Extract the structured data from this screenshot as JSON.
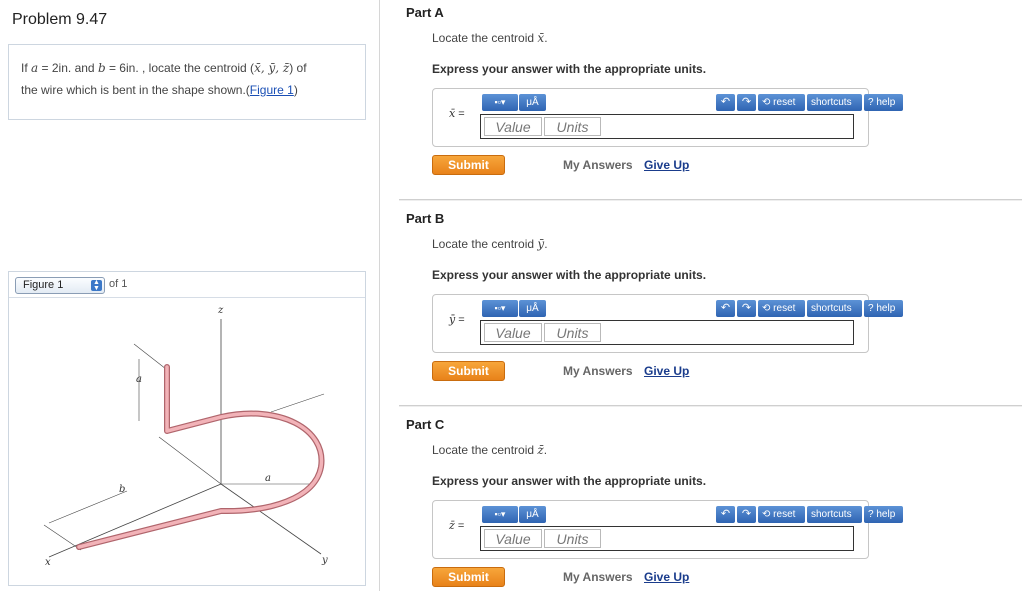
{
  "problem": {
    "title": "Problem 9.47",
    "text_prefix": "If",
    "a_var": "a",
    "a_value": "= 2in.",
    "and": "and",
    "b_var": "b",
    "b_value": "= 6in. , locate the centroid (",
    "centroid_vars": "x̄, ȳ, z̄",
    "text_suffix": ") of",
    "line2": "the wire which is bent in the shape shown.(",
    "figure_link": "Figure 1",
    "close_paren": ")"
  },
  "figure": {
    "select_label": "Figure 1",
    "of_label": "of 1",
    "labels": {
      "z": "z",
      "a_top": "a",
      "b": "b",
      "a_mid": "a",
      "x": "x",
      "y": "y"
    }
  },
  "toolbar": {
    "template_icon": "template-icon",
    "units_label": "μÅ",
    "undo_icon": "undo-icon",
    "redo_icon": "redo-icon",
    "reset_label": "reset",
    "shortcuts_label": "shortcuts",
    "help_label": "help"
  },
  "parts": [
    {
      "title": "Part A",
      "locate": "Locate the centroid",
      "symbol": "x̄",
      "express": "Express your answer with the appropriate units.",
      "var_label": "x̄",
      "value_placeholder": "Value",
      "units_placeholder": "Units",
      "submit": "Submit",
      "my_answers": "My Answers",
      "give_up": "Give Up"
    },
    {
      "title": "Part B",
      "locate": "Locate the centroid",
      "symbol": "ȳ",
      "express": "Express your answer with the appropriate units.",
      "var_label": "ȳ",
      "value_placeholder": "Value",
      "units_placeholder": "Units",
      "submit": "Submit",
      "my_answers": "My Answers",
      "give_up": "Give Up"
    },
    {
      "title": "Part C",
      "locate": "Locate the centroid",
      "symbol": "z̄",
      "express": "Express your answer with the appropriate units.",
      "var_label": "z̄",
      "value_placeholder": "Value",
      "units_placeholder": "Units",
      "submit": "Submit",
      "my_answers": "My Answers",
      "give_up": "Give Up"
    }
  ],
  "colors": {
    "toolbar_blue": "#2f64b2",
    "submit_orange": "#e8821a",
    "link_blue": "#1a4fb5",
    "wire_pink": "#f2b3b8"
  }
}
